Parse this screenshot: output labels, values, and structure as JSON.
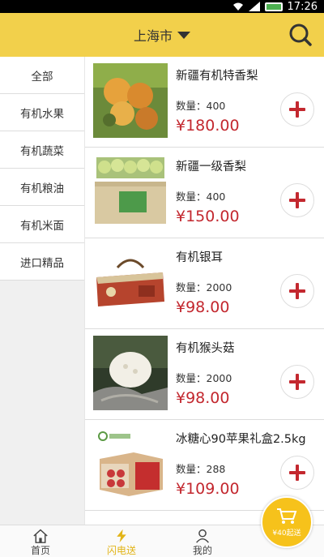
{
  "status": {
    "time": "17:26"
  },
  "header": {
    "city": "上海市"
  },
  "sidebar": {
    "items": [
      {
        "label": "全部"
      },
      {
        "label": "有机水果"
      },
      {
        "label": "有机蔬菜"
      },
      {
        "label": "有机粮油"
      },
      {
        "label": "有机米面"
      },
      {
        "label": "进口精品"
      }
    ]
  },
  "products": [
    {
      "name": "新疆有机特香梨",
      "qty": "数量：400",
      "price": "¥180.00"
    },
    {
      "name": "新疆一级香梨",
      "qty": "数量：400",
      "price": "¥150.00"
    },
    {
      "name": "有机银耳",
      "qty": "数量：2000",
      "price": "¥98.00"
    },
    {
      "name": " 有机猴头菇",
      "qty": "数量：2000",
      "price": "¥98.00"
    },
    {
      "name": "冰糖心90苹果礼盒2.5kg",
      "qty": "数量：288",
      "price": "¥109.00"
    }
  ],
  "tabbar": {
    "home": "首页",
    "flash": "闪电送",
    "mine": "我的"
  },
  "cart": {
    "min_label": "¥40起送"
  },
  "colors": {
    "header": "#f2d04b",
    "price": "#c3282f",
    "tab_active": "#e2b417"
  }
}
